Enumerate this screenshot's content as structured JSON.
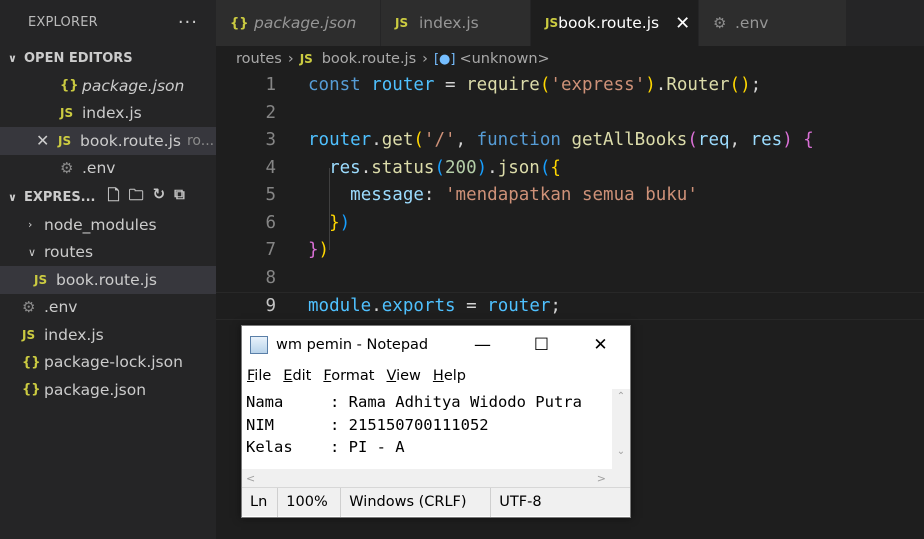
{
  "explorer": {
    "title": "EXPLORER",
    "more": "···",
    "open_editors_label": "OPEN EDITORS",
    "open_editors": [
      {
        "icon": "json-icon",
        "name": "package.json"
      },
      {
        "icon": "js-icon",
        "name": "index.js"
      },
      {
        "icon": "js-icon",
        "name": "book.route.js",
        "path": "ro..."
      },
      {
        "icon": "gear-icon",
        "name": ".env"
      }
    ],
    "project_label": "EXPRES...",
    "tree": [
      {
        "type": "folder",
        "name": "node_modules",
        "expanded": false
      },
      {
        "type": "folder",
        "name": "routes",
        "expanded": true
      },
      {
        "type": "file",
        "icon": "js-icon",
        "name": "book.route.js"
      },
      {
        "type": "file",
        "icon": "gear-icon",
        "name": ".env"
      },
      {
        "type": "file",
        "icon": "js-icon",
        "name": "index.js"
      },
      {
        "type": "file",
        "icon": "json-icon",
        "name": "package-lock.json"
      },
      {
        "type": "file",
        "icon": "json-icon",
        "name": "package.json"
      }
    ]
  },
  "tabs": [
    {
      "icon": "json-icon",
      "label": "package.json"
    },
    {
      "icon": "js-icon",
      "label": "index.js"
    },
    {
      "icon": "js-icon",
      "label": "book.route.js",
      "active": true
    },
    {
      "icon": "gear-icon",
      "label": ".env"
    }
  ],
  "icons": {
    "json": "{}",
    "js": "JS",
    "gear": "⚙",
    "close": "✕",
    "chevron_down": "∨",
    "chevron_right": "›"
  },
  "breadcrumb": {
    "folder": "routes",
    "file": "book.route.js",
    "symbol": "<unknown>"
  },
  "editor": {
    "line_numbers": [
      "1",
      "2",
      "3",
      "4",
      "5",
      "6",
      "7",
      "8",
      "9"
    ],
    "current_line": "9"
  },
  "notepad": {
    "title": "wm pemin - Notepad",
    "menu": [
      "File",
      "Edit",
      "Format",
      "View",
      "Help"
    ],
    "lines": [
      "Nama     : Rama Adhitya Widodo Putra",
      "NIM      : 215150700111052",
      "Kelas    : PI - A"
    ],
    "status": {
      "position": "Ln",
      "zoom": "100%",
      "line_ending": "Windows (CRLF)",
      "encoding": "UTF-8"
    }
  }
}
